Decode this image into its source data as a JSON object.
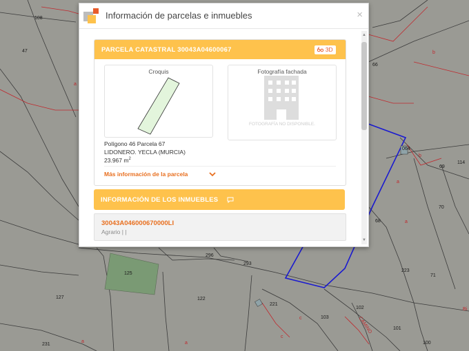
{
  "map": {
    "parcel_labels": [
      "108",
      "47",
      "66",
      "064",
      "114",
      "69",
      "70",
      "68",
      "223",
      "71",
      "296",
      "293",
      "125",
      "127",
      "122",
      "221",
      "102",
      "103",
      "101",
      "100",
      "231"
    ],
    "subparcel_marks": [
      "a",
      "b",
      "c"
    ],
    "road_label": "CAMINO",
    "edge_label": "Bi"
  },
  "dialog": {
    "title": "Información de parcelas e inmuebles",
    "close_label": "×"
  },
  "parcel": {
    "header": "PARCELA CATASTRAL 30043A04600067",
    "btn_3d_label": "3D",
    "sketch_title": "Croquis",
    "photo_title": "Fotografía fachada",
    "photo_unavailable": "FOTOGRAFÍA NO DISPONIBLE.",
    "location_line1": "Polígono 46 Parcela 67",
    "location_line2": "LIDONERO. YECLA (MURCIA)",
    "area_value": "23.967 m",
    "area_exponent": "2",
    "more_info_label": "Más información de la parcela"
  },
  "buildings": {
    "header": "INFORMACIÓN DE LOS INMUEBLES",
    "items": [
      {
        "reference": "30043A046000670000LI",
        "usage": "Agrario | |"
      }
    ]
  },
  "colors": {
    "panel_header": "#fec24c",
    "accent_orange": "#e86f1f",
    "map_background": "#9a9a94",
    "parcel_border_red": "#c0282d",
    "selection_blue": "#1a1ad0",
    "sketch_fill": "#e3f5dc"
  }
}
